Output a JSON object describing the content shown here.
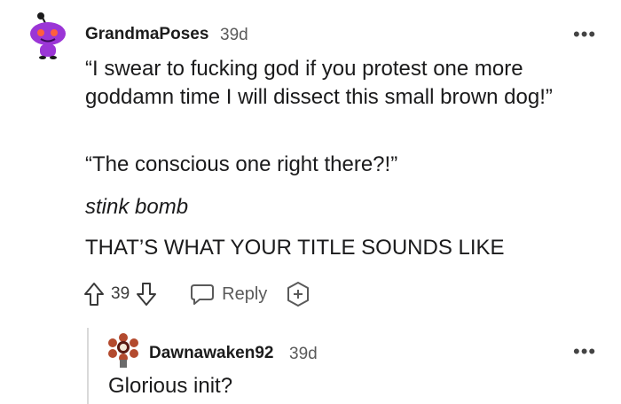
{
  "comment": {
    "username": "GrandmaPoses",
    "age": "39d",
    "more": "•••",
    "paragraphs": [
      "“I swear to fucking god if you protest one more goddamn time I will dissect this small brown dog!”",
      "“The conscious one right there?!”",
      "stink bomb",
      "THAT’S WHAT YOUR TITLE SOUNDS LIKE"
    ],
    "votes": "39",
    "reply_label": "Reply",
    "avatar_color": "#8f2fcf"
  },
  "reply": {
    "username": "Dawnawaken92",
    "age": "39d",
    "more": "•••",
    "text": "Glorious init?"
  },
  "icons": [
    "upvote-icon",
    "downvote-icon",
    "reply-bubble-icon",
    "award-add-icon",
    "more-options-icon"
  ]
}
